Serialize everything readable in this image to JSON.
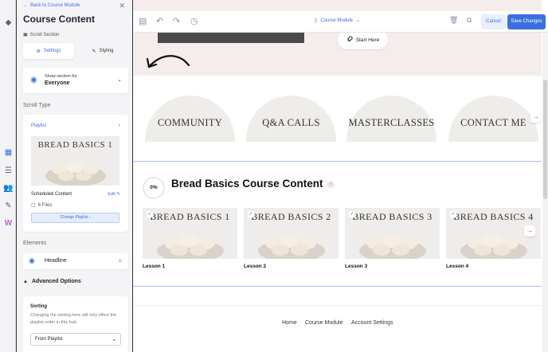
{
  "panel": {
    "back_label": "Back to Course Module",
    "title": "Course Content",
    "scroll_section_label": "Scroll Section",
    "tabs": [
      {
        "label": "Settings",
        "active": true
      },
      {
        "label": "Styling",
        "active": false
      }
    ],
    "visibility": {
      "label": "Show section for",
      "value": "Everyone"
    },
    "scroll_type_label": "Scroll Type",
    "playlist": {
      "title": "Playlist",
      "thumb_text": "BREAD BASICS 1",
      "scheduled_label": "Scheduled Content",
      "edit_label": "Edit",
      "files_label": "6 Files",
      "change_button": "Change Playlist"
    },
    "elements_label": "Elements",
    "element_headline": "Headline",
    "advanced_label": "Advanced Options",
    "sorting": {
      "title": "Sorting",
      "description": "Changing the sorting here will only effect the playlist order in this hub.",
      "select_value": "From Playlist"
    }
  },
  "toolbar": {
    "module_label": "Course Module",
    "cancel_label": "Cancel",
    "save_label": "Save Changes"
  },
  "hero": {
    "start_label": "Start Here"
  },
  "nav_arches": [
    "COMMUNITY",
    "Q&A CALLS",
    "MASTERCLASSES",
    "CONTACT ME"
  ],
  "course": {
    "progress": "0%",
    "title": "Bread Basics Course Content",
    "lessons": [
      {
        "thumb": "BREAD BASICS 1",
        "label": "Lesson 1"
      },
      {
        "thumb": "BREAD BASICS 2",
        "label": "Lesson 2"
      },
      {
        "thumb": "BREAD BASICS 3",
        "label": "Lesson 3"
      },
      {
        "thumb": "BREAD BASICS 4",
        "label": "Lesson 4"
      }
    ]
  },
  "footer": {
    "links": [
      "Home",
      "Course Module",
      "Account Settings"
    ]
  },
  "colors": {
    "accent": "#3b6fe0",
    "hero_bg": "#f5ecec",
    "arch_bg": "#efedea",
    "arrow": "#e04848"
  }
}
